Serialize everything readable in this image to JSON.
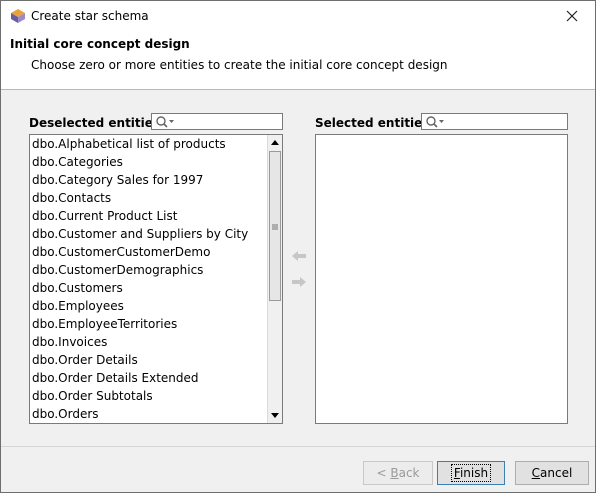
{
  "window": {
    "title": "Create star schema"
  },
  "header": {
    "title": "Initial core concept design",
    "description": "Choose zero or more entities to create the initial core concept design"
  },
  "deselected": {
    "label": "Deselected entities:",
    "items": [
      "dbo.Alphabetical list of products",
      "dbo.Categories",
      "dbo.Category Sales for 1997",
      "dbo.Contacts",
      "dbo.Current Product List",
      "dbo.Customer and Suppliers by City",
      "dbo.CustomerCustomerDemo",
      "dbo.CustomerDemographics",
      "dbo.Customers",
      "dbo.Employees",
      "dbo.EmployeeTerritories",
      "dbo.Invoices",
      "dbo.Order Details",
      "dbo.Order Details Extended",
      "dbo.Order Subtotals",
      "dbo.Orders"
    ]
  },
  "selected": {
    "label": "Selected entities:",
    "items": []
  },
  "buttons": {
    "back": {
      "pre": "< ",
      "mnemonic": "B",
      "rest": "ack"
    },
    "finish": {
      "pre": "",
      "mnemonic": "F",
      "rest": "inish"
    },
    "cancel": {
      "pre": "",
      "mnemonic": "C",
      "rest": "ancel"
    }
  }
}
